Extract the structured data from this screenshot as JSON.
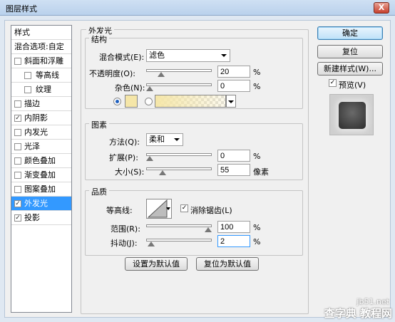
{
  "window": {
    "title": "图层样式",
    "close_label": "X"
  },
  "left_panel": {
    "styles_header": "样式",
    "blend_options": "混合选项:自定",
    "items": [
      {
        "label": "斜面和浮雕",
        "checked": false,
        "indent": false
      },
      {
        "label": "等高线",
        "checked": false,
        "indent": true
      },
      {
        "label": "纹理",
        "checked": false,
        "indent": true
      },
      {
        "label": "描边",
        "checked": false,
        "indent": false
      },
      {
        "label": "内阴影",
        "checked": true,
        "indent": false
      },
      {
        "label": "内发光",
        "checked": false,
        "indent": false
      },
      {
        "label": "光泽",
        "checked": false,
        "indent": false
      },
      {
        "label": "颜色叠加",
        "checked": false,
        "indent": false
      },
      {
        "label": "渐变叠加",
        "checked": false,
        "indent": false
      },
      {
        "label": "图案叠加",
        "checked": false,
        "indent": false
      },
      {
        "label": "外发光",
        "checked": true,
        "indent": false,
        "selected": true
      },
      {
        "label": "投影",
        "checked": true,
        "indent": false
      }
    ]
  },
  "outer_glow": {
    "title": "外发光",
    "structure": {
      "title": "结构",
      "blend_mode_label": "混合模式(E):",
      "blend_mode_value": "滤色",
      "opacity_label": "不透明度(O):",
      "opacity_value": "20",
      "opacity_unit": "%",
      "opacity_level": 0.2,
      "noise_label": "杂色(N):",
      "noise_value": "0",
      "noise_unit": "%",
      "noise_level": 0.0,
      "glow_color": "#f5e6a8"
    },
    "elements": {
      "title": "图素",
      "method_label": "方法(Q):",
      "method_value": "柔和",
      "spread_label": "扩展(P):",
      "spread_value": "0",
      "spread_unit": "%",
      "spread_level": 0.0,
      "size_label": "大小(S):",
      "size_value": "55",
      "size_unit": "像素",
      "size_level": 0.22
    },
    "quality": {
      "title": "品质",
      "contour_label": "等高线:",
      "antialias_label": "消除锯齿(L)",
      "antialias_checked": true,
      "range_label": "范围(R):",
      "range_value": "100",
      "range_unit": "%",
      "range_level": 1.0,
      "jitter_label": "抖动(J):",
      "jitter_value": "2",
      "jitter_unit": "%",
      "jitter_level": 0.02
    },
    "make_default": "设置为默认值",
    "reset_default": "复位为默认值"
  },
  "right_panel": {
    "ok": "确定",
    "reset": "复位",
    "new_style": "新建样式(W)...",
    "preview_label": "预览(V)",
    "preview_checked": true
  },
  "watermark": {
    "line1": "jb51.net",
    "line2": "查字典 教程网"
  }
}
